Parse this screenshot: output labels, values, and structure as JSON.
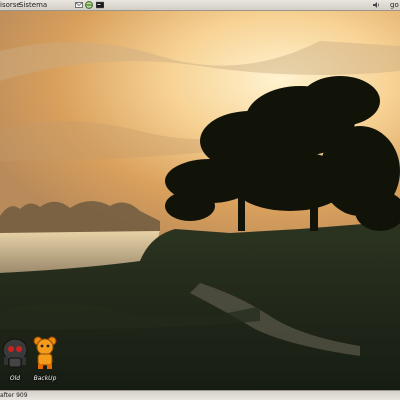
{
  "top_panel": {
    "menu_resources": "isorse",
    "menu_system": "Sistema",
    "user_label": "go"
  },
  "desktop": {
    "icons": [
      {
        "label": "Old",
        "icon": "robot-icon"
      },
      {
        "label": "BackUp",
        "icon": "bear-icon"
      }
    ]
  },
  "bottom_panel": {
    "window_button": "after 909"
  },
  "colors": {
    "sky_bright": "#fff2c8",
    "sky_warm": "#f2b35c",
    "ground_dark": "#1d2418",
    "panel": "#e1ded6"
  }
}
